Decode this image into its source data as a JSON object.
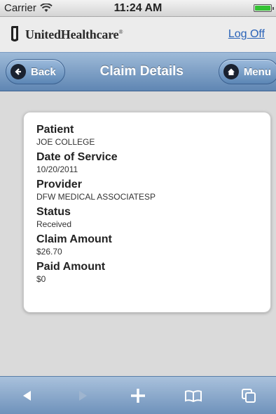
{
  "status_bar": {
    "carrier": "Carrier",
    "time": "11:24 AM"
  },
  "header": {
    "brand": "UnitedHealthcare",
    "brand_mark": "®",
    "logoff_label": "Log Off"
  },
  "nav": {
    "back_label": "Back",
    "title": "Claim Details",
    "menu_label": "Menu"
  },
  "claim": {
    "fields": [
      {
        "label": "Patient",
        "value": "JOE COLLEGE"
      },
      {
        "label": "Date of Service",
        "value": "10/20/2011"
      },
      {
        "label": "Provider",
        "value": "DFW MEDICAL ASSOCIATESP"
      },
      {
        "label": "Status",
        "value": "Received"
      },
      {
        "label": "Claim Amount",
        "value": "$26.70"
      },
      {
        "label": "Paid Amount",
        "value": "$0"
      }
    ]
  },
  "toolbar": {
    "icons": [
      "back-arrow-icon",
      "forward-arrow-icon",
      "add-icon",
      "bookmarks-icon",
      "tabs-icon"
    ]
  },
  "colors": {
    "nav_blue": "#6f92bb",
    "link_blue": "#2a63b8",
    "battery_green": "#34c234"
  }
}
